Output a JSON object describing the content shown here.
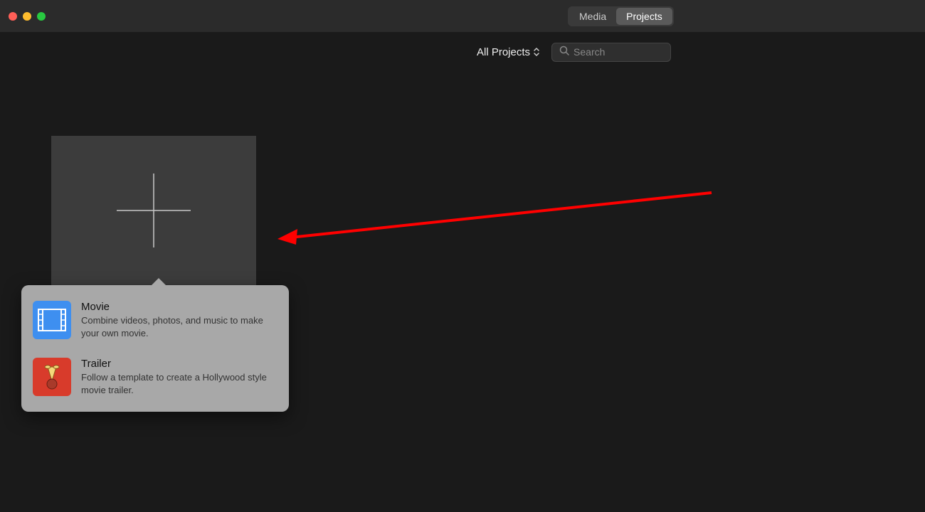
{
  "tabs": {
    "media": "Media",
    "projects": "Projects"
  },
  "toolbar": {
    "filter_label": "All Projects",
    "search_placeholder": "Search"
  },
  "popover": {
    "movie": {
      "title": "Movie",
      "desc": "Combine videos, photos, and music to make your own movie."
    },
    "trailer": {
      "title": "Trailer",
      "desc": "Follow a template to create a Hollywood style movie trailer."
    }
  }
}
